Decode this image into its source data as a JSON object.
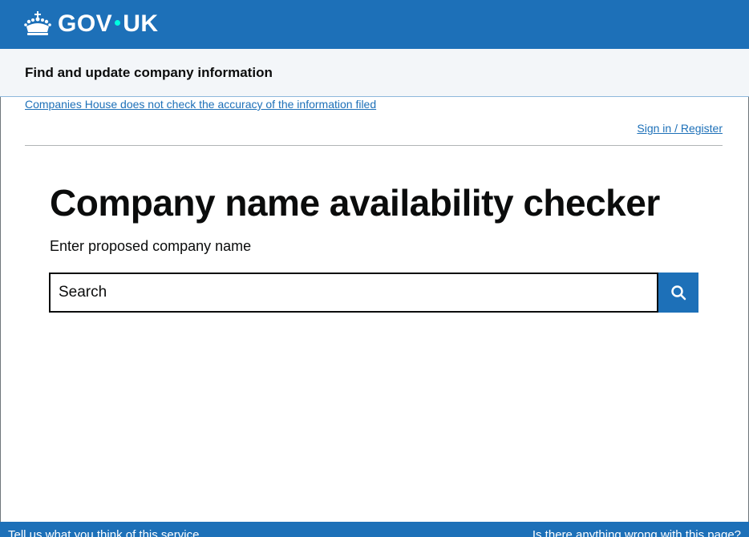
{
  "header": {
    "logo_left": "GOV",
    "logo_right": "UK",
    "crown_icon": "crown-icon",
    "background_color": "#1d70b8"
  },
  "service": {
    "name": "Find and update company information"
  },
  "notices": {
    "accuracy_link": "Companies House does not check the accuracy of the information filed"
  },
  "account": {
    "signin_link": "Sign in / Register"
  },
  "main": {
    "title": "Company name availability checker",
    "label": "Enter proposed company name",
    "search": {
      "placeholder": "Search",
      "value": "",
      "button_icon": "search-icon"
    }
  },
  "feedback": {
    "left_link": "Tell us what you think of this service",
    "right_link": "Is there anything wrong with this page?"
  }
}
